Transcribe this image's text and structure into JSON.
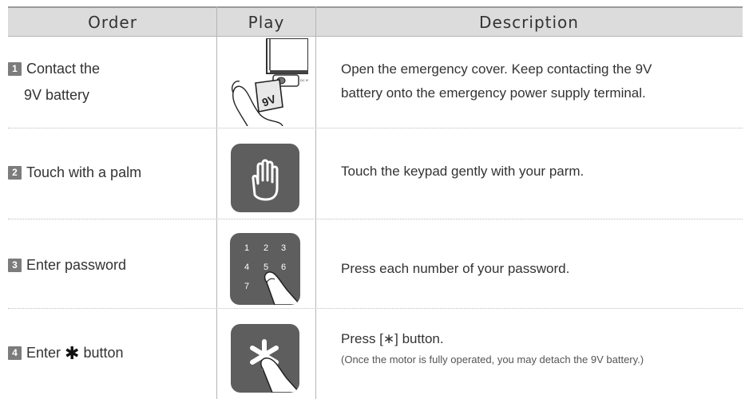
{
  "header": {
    "order": "Order",
    "play": "Play",
    "description": "Description"
  },
  "rows": [
    {
      "num": "1",
      "order_line1": "Contact the",
      "order_line2": "9V battery",
      "desc_line1": "Open the emergency cover. Keep contacting the 9V",
      "desc_line2": "battery onto the emergency power supply terminal.",
      "battery_label": "9V"
    },
    {
      "num": "2",
      "order": "Touch with a palm",
      "desc": "Touch the keypad gently with your parm."
    },
    {
      "num": "3",
      "order": "Enter password",
      "desc": "Press each number of your password.",
      "keypad": [
        "1",
        "2",
        "3",
        "4",
        "5",
        "6",
        "7"
      ]
    },
    {
      "num": "4",
      "order_pre": "Enter",
      "order_symbol": "✱",
      "order_post": "button",
      "desc": "Press [∗] button.",
      "note": "(Once the motor is fully operated, you may detach the 9V battery.)"
    }
  ],
  "icons": {
    "battery": "battery-contact-illustration",
    "palm": "palm-hand-icon",
    "keypad": "keypad-finger-illustration",
    "star": "star-button-finger-illustration"
  }
}
